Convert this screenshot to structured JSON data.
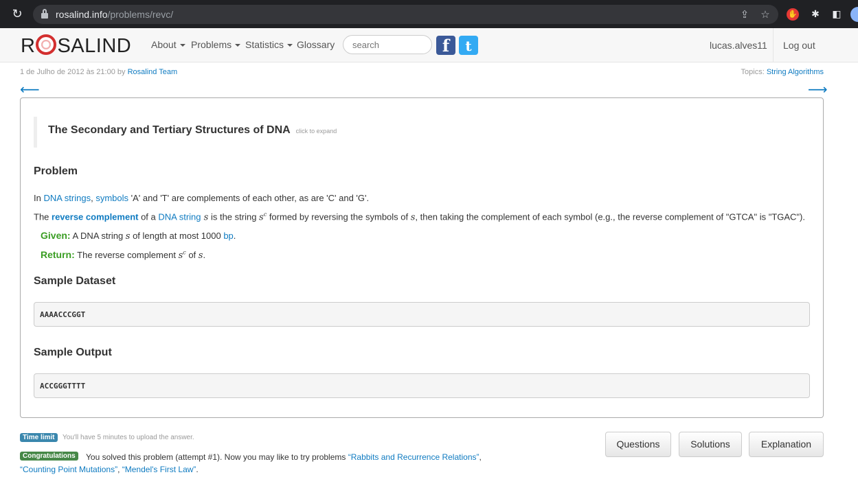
{
  "browser": {
    "url_host": "rosalind.info",
    "url_path": "/problems/revc/"
  },
  "navbar": {
    "brand_left": "R",
    "brand_right": "SALIND",
    "items": [
      {
        "label": "About"
      },
      {
        "label": "Problems"
      },
      {
        "label": "Statistics"
      },
      {
        "label": "Glossary"
      }
    ],
    "search_placeholder": "search",
    "username": "lucas.alves11",
    "logout": "Log out"
  },
  "meta": {
    "date": "1 de Julho de 2012 às 21:00 by ",
    "author": "Rosalind Team",
    "topics_label": "Topics: ",
    "topics": "String Algorithms",
    "prev_arrow": "⟵",
    "next_arrow": "⟶"
  },
  "problem": {
    "title": "The Secondary and Tertiary Structures of DNA",
    "expand_hint": "click to expand",
    "problem_heading": "Problem",
    "p1": {
      "t1": "In ",
      "link1": "DNA strings",
      "t2": ", ",
      "link2": "symbols",
      "t3": " 'A' and 'T' are complements of each other, as are 'C' and 'G'."
    },
    "p2": {
      "t1": "The ",
      "bold_link": "reverse complement",
      "t2": " of a ",
      "link": "DNA string",
      "t3": " s",
      "t4": " is the string ",
      "s": "s",
      "sup": "c",
      "t5": " formed by reversing the symbols of ",
      "s2": "s",
      "t6": ", then taking the complement of each symbol (e.g., the reverse complement of \"GTCA\" is \"TGAC\")."
    },
    "given": {
      "label": "Given:",
      "t1": " A DNA string ",
      "s": "s",
      "t2": " of length at most 1000 ",
      "link": "bp",
      "t3": "."
    },
    "return": {
      "label": "Return:",
      "t1": " The reverse complement ",
      "s": "s",
      "sup": "c",
      "t2": " of ",
      "s2": "s",
      "t3": "."
    },
    "sample_dataset_heading": "Sample Dataset",
    "sample_dataset": "AAAACCCGGT",
    "sample_output_heading": "Sample Output",
    "sample_output": "ACCGGGTTTT"
  },
  "footer": {
    "time_limit_label": "Time limit",
    "time_limit_text": "You'll have 5 minutes to upload the answer.",
    "congrats_label": "Congratulations",
    "congrats_text": " You solved this problem (attempt #1). Now you may like to try problems ",
    "link1": "“Rabbits and Recurrence Relations”",
    "sep1": ", ",
    "link2": "“Counting Point Mutations”",
    "sep2": ", ",
    "link3": "“Mendel's First Law”",
    "end": ".",
    "buttons": {
      "questions": "Questions",
      "solutions": "Solutions",
      "explanation": "Explanation"
    }
  },
  "colors": {
    "link": "#0f7bc1",
    "given_green": "#3a9d23",
    "time_limit_badge": "#3a87ad",
    "congrats_badge": "#468847",
    "logo_red": "#d32f2f"
  }
}
